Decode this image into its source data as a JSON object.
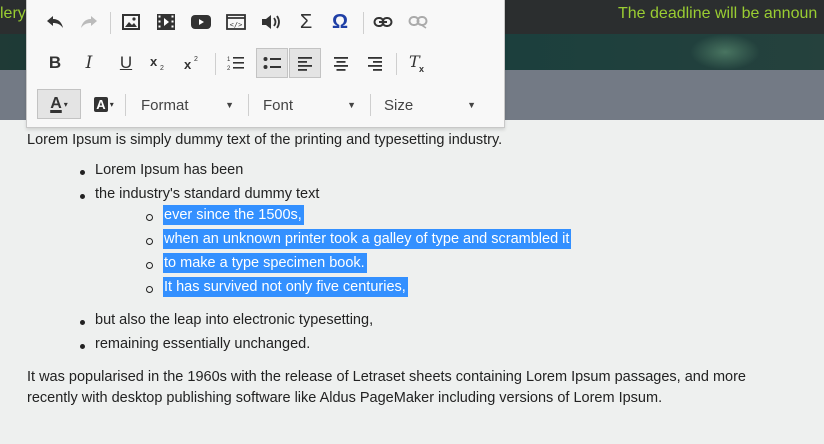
{
  "topbar": {
    "left_text": "lery",
    "marquee": "The deadline will be announ"
  },
  "toolbar": {
    "row1_icons": [
      "undo-icon",
      "redo-icon",
      "image-icon",
      "video-icon",
      "youtube-icon",
      "iframe-icon",
      "audio-icon",
      "sigma-icon",
      "omega-icon",
      "link-icon",
      "unlink-icon"
    ],
    "row2_icons": [
      "bold-icon",
      "italic-icon",
      "underline-icon",
      "subscript-icon",
      "superscript-icon",
      "numbered-list-icon",
      "bulleted-list-icon",
      "align-left-icon",
      "align-center-icon",
      "align-right-icon",
      "remove-format-icon"
    ],
    "bold": "B",
    "italic": "I",
    "underline": "U",
    "text_color_letter": "A",
    "bg_color_letter": "A",
    "format_label": "Format",
    "font_label": "Font",
    "size_label": "Size"
  },
  "content": {
    "intro": "Lorem Ipsum is simply dummy text of the printing and typesetting industry.",
    "bullets_top": [
      "Lorem Ipsum has been",
      "the industry's standard dummy text"
    ],
    "sub_items": [
      "ever since the 1500s,",
      "when an unknown printer took a galley of type and scrambled it",
      "to make a type specimen book.",
      "It has survived not only five centuries,"
    ],
    "bullets_bottom": [
      "but also the leap into electronic typesetting,",
      "remaining essentially unchanged."
    ],
    "outro_line1": "It was popularised in the 1960s with the release of Letraset sheets containing Lorem Ipsum passages, and more",
    "outro_line2": "recently with desktop publishing software like Aldus PageMaker including versions of Lorem Ipsum."
  },
  "colors": {
    "selection": "#3390ff",
    "marquee_text": "#9acd32"
  }
}
